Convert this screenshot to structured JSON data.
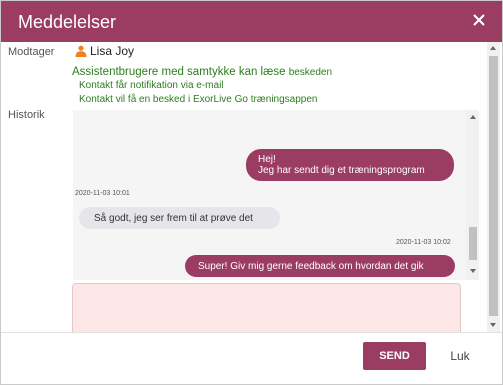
{
  "dialog": {
    "title": "Meddelelser",
    "close_icon": "close-icon",
    "accent_color": "#9b3d63"
  },
  "recipient": {
    "label": "Modtager",
    "name": "Lisa Joy",
    "icon": "person-icon",
    "icon_color": "#f0821e"
  },
  "notice": {
    "main": "Assistentbrugere med samtykke kan læse",
    "main_small": "beskeden",
    "lines": [
      "Kontakt får notifikation via e-mail",
      "Kontakt vil få en besked i ExorLive Go træningsappen"
    ],
    "color": "#2e7d1f"
  },
  "history": {
    "label": "Historik",
    "messages": [
      {
        "direction": "sent",
        "lines": [
          "Hej!",
          "Jeg har sendt dig et træningsprogram"
        ],
        "timestamp": "2020-11-03 10:01"
      },
      {
        "direction": "received",
        "lines": [
          "Så godt, jeg ser frem til at prøve det"
        ],
        "timestamp": "2020-11-03 10:02"
      },
      {
        "direction": "sent",
        "lines": [
          "Super! Giv mig gerne feedback om hvordan det gik"
        ]
      }
    ]
  },
  "compose": {
    "value": "",
    "placeholder": ""
  },
  "footer": {
    "send_label": "SEND",
    "close_label": "Luk"
  }
}
